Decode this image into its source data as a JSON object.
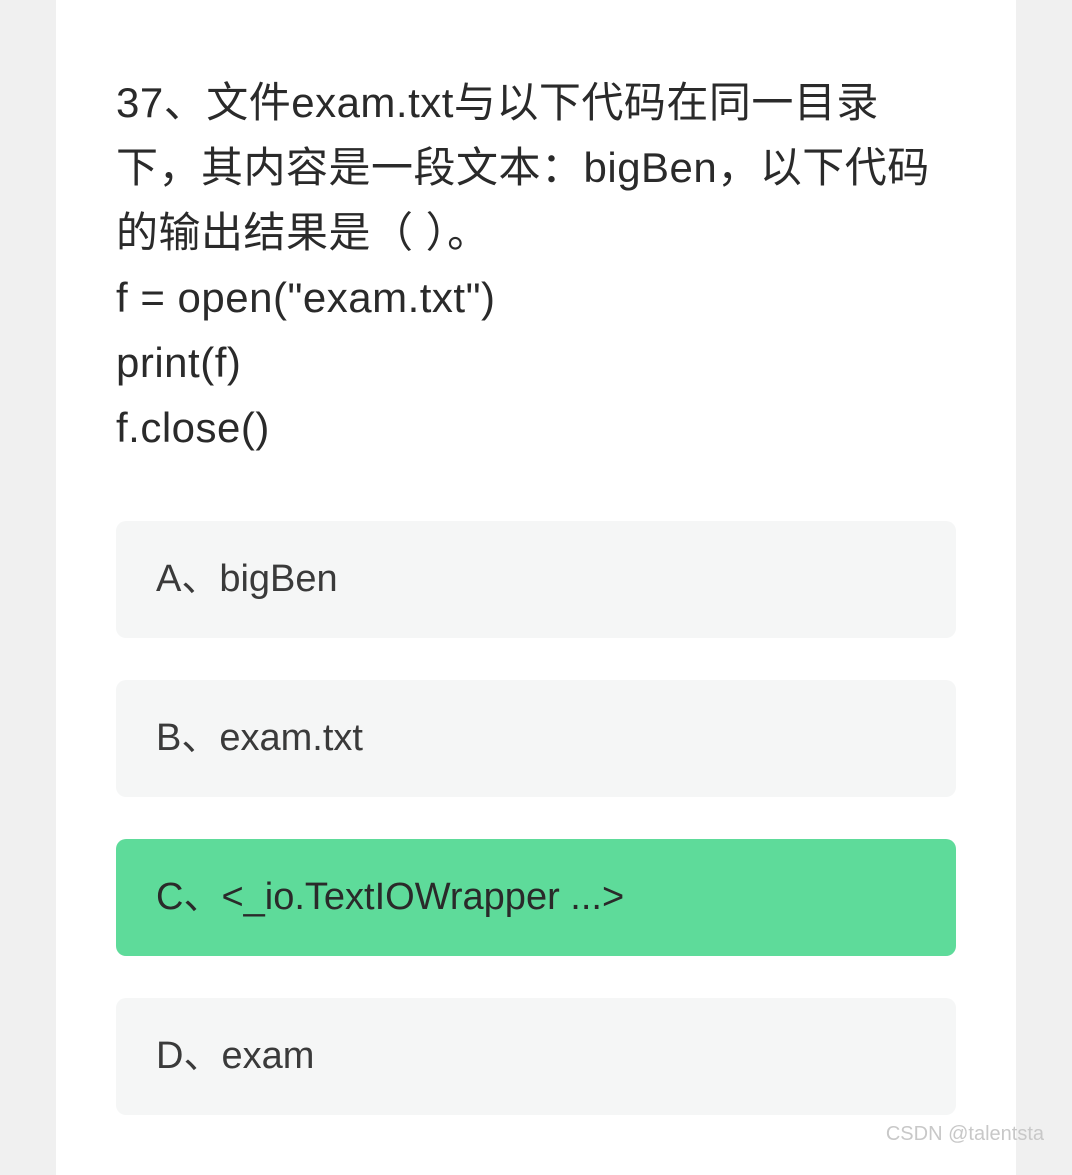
{
  "question": {
    "stem_line1": "37、文件exam.txt与以下代码在同一目录下，其内容是一段文本：bigBen，以下代码的输出结果是（ ）。",
    "code_line1": "f = open(\"exam.txt\")",
    "code_line2": "print(f)",
    "code_line3": "f.close()"
  },
  "options": {
    "a": "A、bigBen",
    "b": "B、exam.txt",
    "c": "C、<_io.TextIOWrapper ...>",
    "d": "D、exam"
  },
  "selected": "c",
  "watermark": "CSDN @talentsta"
}
